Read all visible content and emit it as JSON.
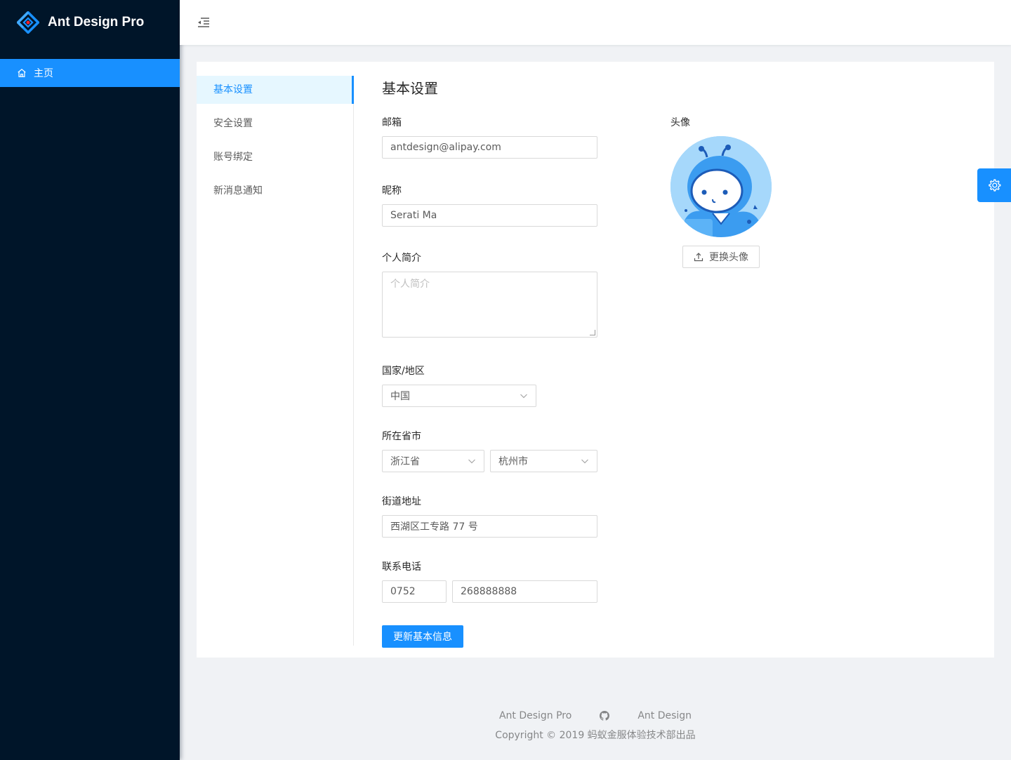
{
  "app": {
    "title": "Ant Design Pro"
  },
  "sidebar": {
    "items": [
      {
        "label": "主页",
        "icon": "home-icon",
        "active": true
      }
    ]
  },
  "header": {
    "trigger_icon": "menu-fold-icon"
  },
  "settings_menu": {
    "items": [
      {
        "label": "基本设置",
        "active": true
      },
      {
        "label": "安全设置"
      },
      {
        "label": "账号绑定"
      },
      {
        "label": "新消息通知"
      }
    ]
  },
  "page": {
    "title": "基本设置"
  },
  "form": {
    "email": {
      "label": "邮箱",
      "value": "antdesign@alipay.com"
    },
    "nickname": {
      "label": "昵称",
      "value": "Serati Ma"
    },
    "profile": {
      "label": "个人简介",
      "placeholder": "个人简介"
    },
    "country": {
      "label": "国家/地区",
      "value": "中国"
    },
    "region": {
      "label": "所在省市",
      "province": "浙江省",
      "city": "杭州市"
    },
    "address": {
      "label": "街道地址",
      "value": "西湖区工专路 77 号"
    },
    "phone": {
      "label": "联系电话",
      "area_code": "0752",
      "number": "268888888"
    },
    "submit_label": "更新基本信息"
  },
  "avatar": {
    "label": "头像",
    "button_label": "更换头像"
  },
  "footer": {
    "links": [
      "Ant Design Pro",
      "Ant Design"
    ],
    "github_icon": "github-icon",
    "copyright": "Copyright © 2019 蚂蚁金服体验技术部出品"
  },
  "colors": {
    "primary": "#1890ff",
    "sider": "#001529"
  }
}
